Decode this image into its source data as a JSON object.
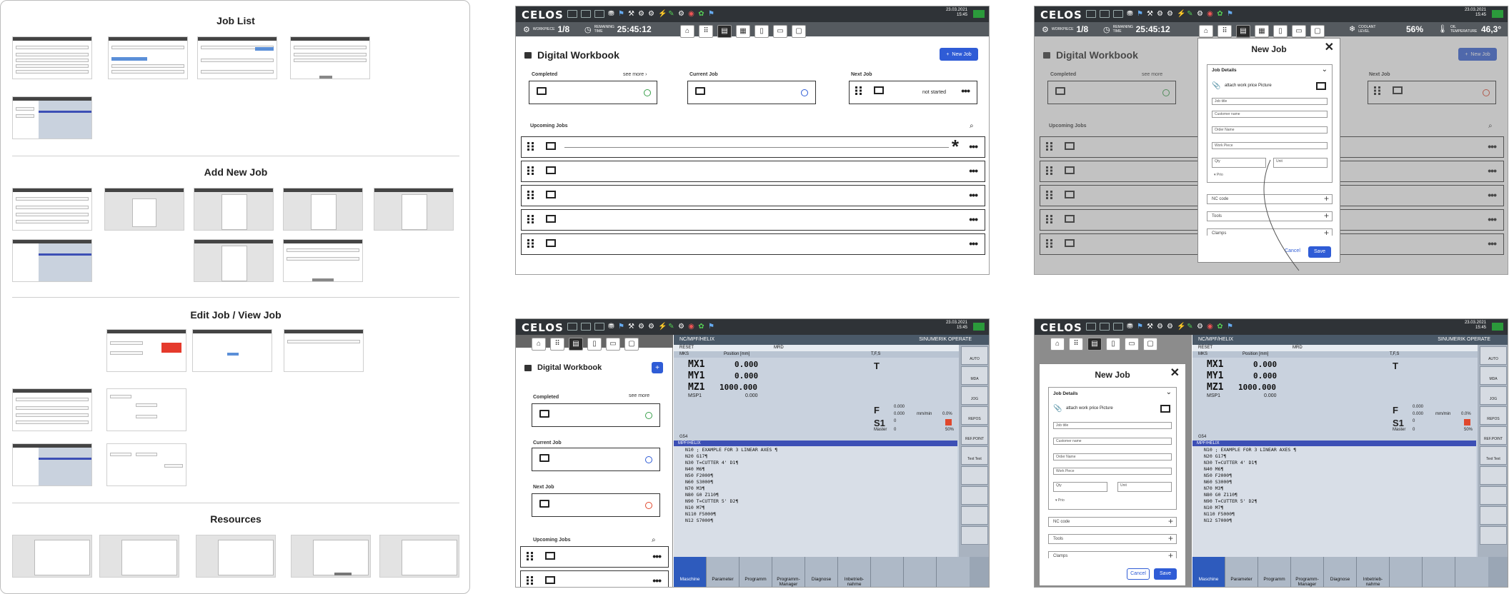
{
  "overview": {
    "sections": [
      {
        "title": "Job List"
      },
      {
        "title": "Add New Job"
      },
      {
        "title": "Edit Job / View Job"
      },
      {
        "title": "Resources"
      }
    ]
  },
  "app": {
    "brand": "CELOS",
    "date": "23.03.2021",
    "time": "15:45",
    "workpiece_label": "WORKPIECE",
    "workpiece_count": "1/8",
    "remaining_label": "REMAINING TIME",
    "remaining_time": "25:45:12",
    "coolant_label": "COOLANT LEVEL",
    "coolant_value": "56%",
    "oil_label": "OIL TEMPERATURE",
    "oil_value": "46,3°"
  },
  "workbook": {
    "title": "Digital Workbook",
    "new_job": "New Job",
    "completed_label": "Completed",
    "see_more": "see more",
    "current_label": "Current Job",
    "next_label": "Next Job",
    "not_started": "not started",
    "upcoming_label": "Upcoming Jobs",
    "more": "•••"
  },
  "new_job_modal": {
    "title": "New Job",
    "section": "Job Details",
    "attach": "attach work price Picture",
    "fields": [
      "Job title",
      "Customer name",
      "Order Name",
      "Work Piece"
    ],
    "pair": [
      "Qty",
      "Unit"
    ],
    "priority": "▾ Prio",
    "expanders": [
      "NC code",
      "Tools",
      "Clamps"
    ],
    "cancel": "Cancel",
    "save": "Save"
  },
  "cnc": {
    "path": "NC/MPF/HELIX",
    "operate": "SINUMERIK OPERATE",
    "reset": "RESET",
    "mrd": "MRD",
    "mks": "MKS",
    "position_hdr": "Position [mm]",
    "tfs_hdr": "T,F,S",
    "axes": [
      {
        "name": "MX1",
        "value": "0.000"
      },
      {
        "name": "MY1",
        "value": "0.000"
      },
      {
        "name": "MZ1",
        "value": "1000.000"
      }
    ],
    "msp1": "MSP1",
    "msp1_value": "0.000",
    "t_label": "T",
    "f_label": "F",
    "f_value": "0.000",
    "f_value2": "0.000",
    "f_unit": "mm/min",
    "f_pct": "0.0%",
    "s_label": "S1",
    "s_value": "0",
    "s_value2": "0",
    "master": "Master",
    "s_pct": "50%",
    "g54": "G54",
    "prog_header": "MPF/HELIX",
    "lines": [
      "N10 ; EXAMPLE FOR 3 LINEAR AXES ¶",
      "N20 G17¶",
      "N30 T=CUTTER 4' D1¶",
      "N40 M6¶",
      "N50 F2000¶",
      "N60 S3000¶",
      "N70 M3¶",
      "N80 G0 Z110¶",
      "N90 T=CUTTER 5' D2¶",
      "N10 M7¶",
      "N110 F5000¶",
      "N12 S7000¶"
    ],
    "side_buttons": [
      "AUTO",
      "MDA",
      "JOG",
      "REPOS",
      "REF.POINT",
      "Text\nText",
      "",
      "",
      "",
      ""
    ],
    "bottom_buttons": [
      "Maschine",
      "Parameter",
      "Programm",
      "Programm-\nManager",
      "Diagnose",
      "Inbetrieb-\nnahme"
    ]
  }
}
